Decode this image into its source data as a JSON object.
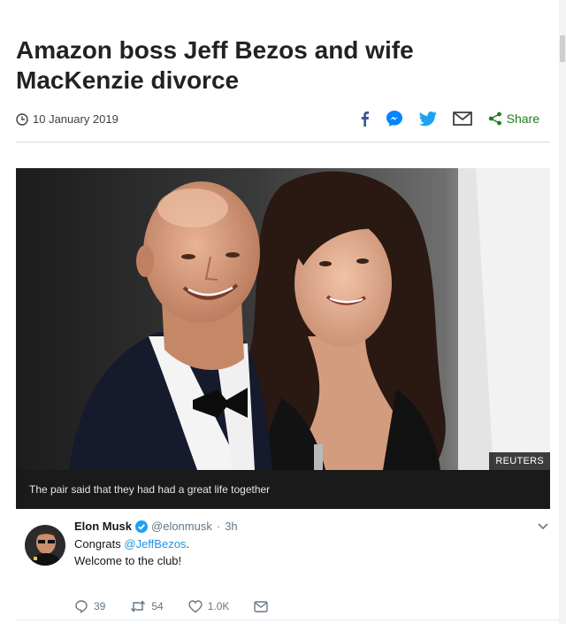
{
  "article": {
    "headline": "Amazon boss Jeff Bezos and wife MacKenzie divorce",
    "date": "10 January 2019",
    "share_label": "Share"
  },
  "share_icons": [
    "facebook-icon",
    "messenger-icon",
    "twitter-icon",
    "email-icon",
    "share-icon"
  ],
  "colors": {
    "facebook": "#3b5998",
    "messenger": "#0084ff",
    "twitter": "#1da1f2",
    "share_green": "#1a7f1a",
    "caption_bg": "#1a1a1a",
    "mention": "#1b95e0"
  },
  "image": {
    "credit": "REUTERS",
    "caption": "The pair said that they had had a great life together"
  },
  "tweet": {
    "author_name": "Elon Musk",
    "author_handle": "@elonmusk",
    "separator": "·",
    "time": "3h",
    "line1_prefix": "Congrats ",
    "mention": "@JeffBezos",
    "line1_suffix": ".",
    "line2": "Welcome to the club!",
    "replies": "39",
    "retweets": "54",
    "likes": "1.0K"
  }
}
